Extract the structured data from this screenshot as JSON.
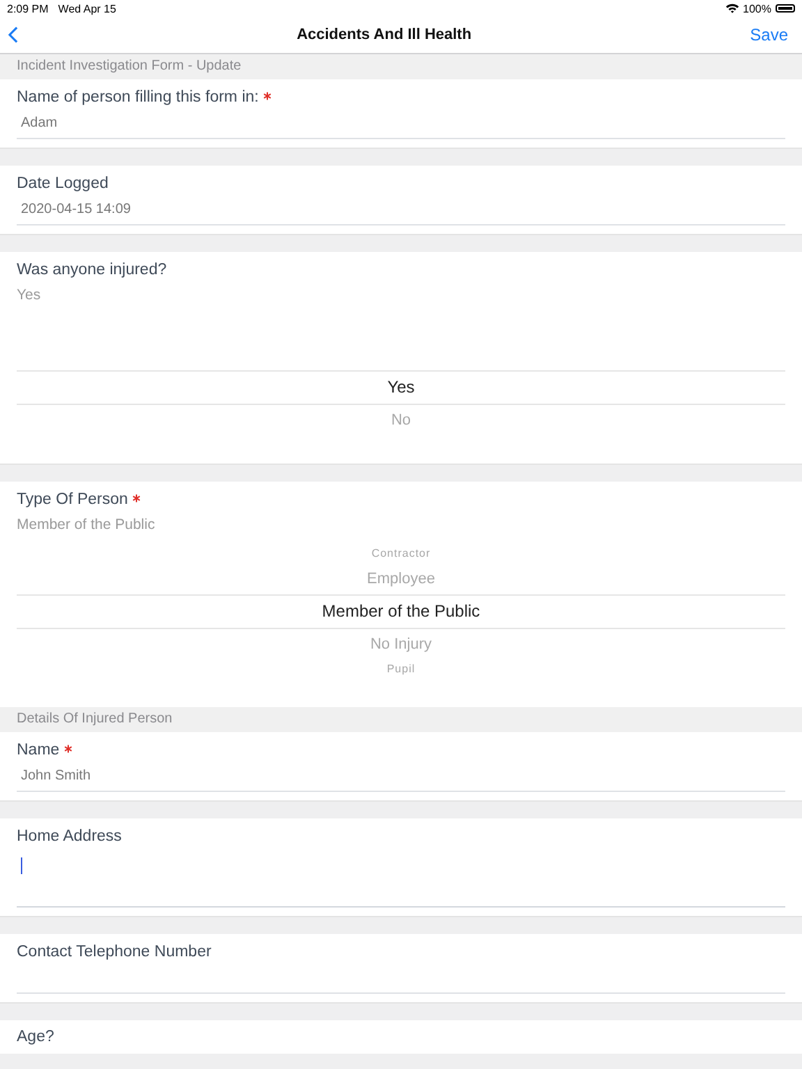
{
  "status_bar": {
    "time": "2:09 PM",
    "date": "Wed Apr 15",
    "battery": "100%"
  },
  "nav_bar": {
    "title": "Accidents And Ill Health",
    "action": "Save"
  },
  "sections": [
    {
      "kind": "header",
      "title": "Incident Investigation Form - Update"
    },
    {
      "kind": "field",
      "label": "Name of person filling this form in:",
      "required": true,
      "value": "Adam"
    },
    {
      "kind": "field",
      "label": "Date Logged",
      "value": "2020-04-15 14:09"
    },
    {
      "kind": "picker",
      "label": "Was anyone injured?",
      "value": "Yes",
      "options": [
        {
          "label": "Yes",
          "selected": true
        },
        {
          "label": "No",
          "selected": false
        }
      ]
    },
    {
      "kind": "picker",
      "label": "Type Of Person",
      "required": true,
      "value": "Member of the Public",
      "options": [
        {
          "label": "Contractor",
          "selected": false
        },
        {
          "label": "Employee",
          "selected": false
        },
        {
          "label": "Member of the Public",
          "selected": true
        },
        {
          "label": "No Injury",
          "selected": false
        },
        {
          "label": "Pupil",
          "selected": false
        }
      ]
    },
    {
      "kind": "header",
      "title": "Details Of Injured Person"
    },
    {
      "kind": "field",
      "label": "Name",
      "required": true,
      "value": "John Smith"
    },
    {
      "kind": "textarea",
      "label": "Home Address",
      "focused": true
    },
    {
      "kind": "field",
      "label": "Contact Telephone Number"
    },
    {
      "kind": "label",
      "label": "Age?"
    }
  ]
}
